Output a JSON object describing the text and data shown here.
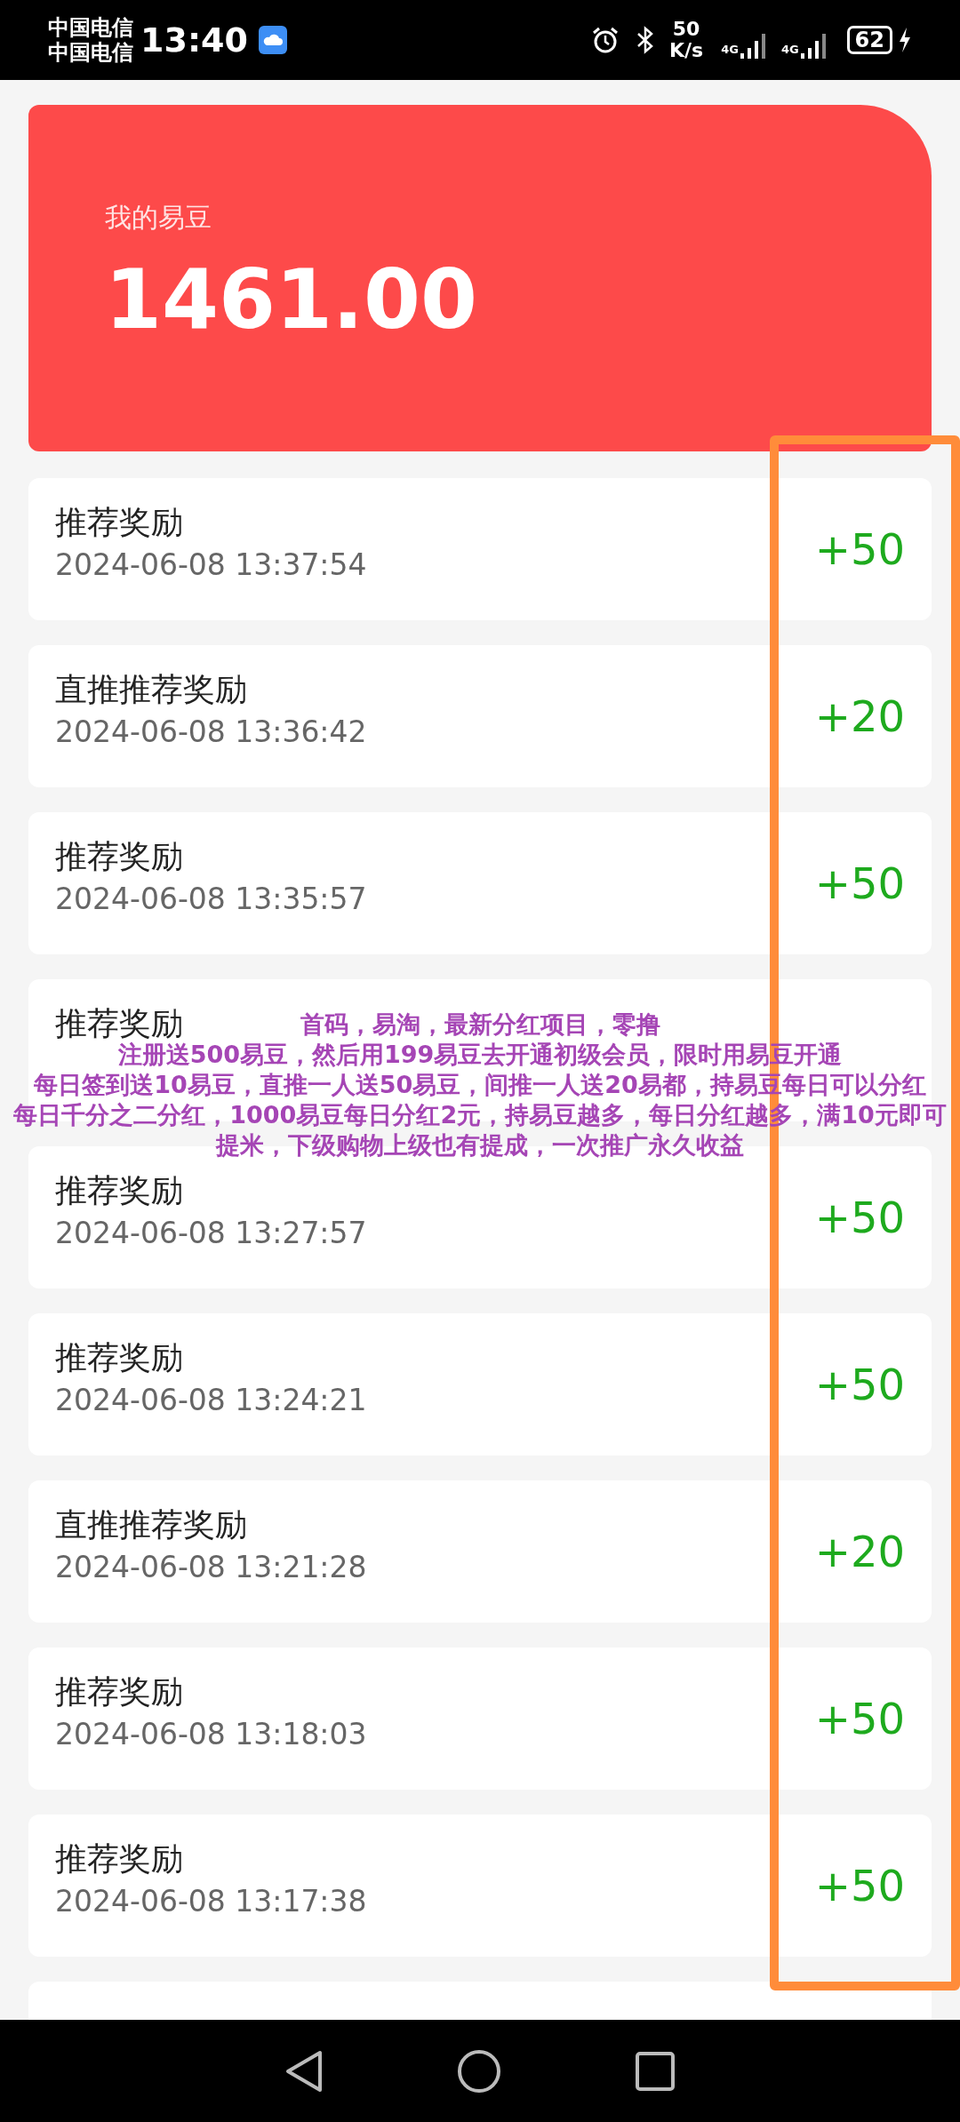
{
  "status_bar": {
    "carriers": [
      "中国电信",
      "中国电信"
    ],
    "time": "13:40",
    "speed_value": "50",
    "speed_unit": "K/s",
    "network_labels": [
      "4G",
      "4G"
    ],
    "battery": "62"
  },
  "balance": {
    "label": "我的易豆",
    "value": "1461.00"
  },
  "records": [
    {
      "title": "推荐奖励",
      "time": "2024-06-08 13:37:54",
      "amount": "+50"
    },
    {
      "title": "直推推荐奖励",
      "time": "2024-06-08 13:36:42",
      "amount": "+20"
    },
    {
      "title": "推荐奖励",
      "time": "2024-06-08 13:35:57",
      "amount": "+50"
    },
    {
      "title": "推荐奖励"
    },
    {
      "title": "推荐奖励",
      "time": "2024-06-08 13:27:57",
      "amount": "+50"
    },
    {
      "title": "推荐奖励",
      "time": "2024-06-08 13:24:21",
      "amount": "+50"
    },
    {
      "title": "直推推荐奖励",
      "time": "2024-06-08 13:21:28",
      "amount": "+20"
    },
    {
      "title": "推荐奖励",
      "time": "2024-06-08 13:18:03",
      "amount": "+50"
    },
    {
      "title": "推荐奖励",
      "time": "2024-06-08 13:17:38",
      "amount": "+50"
    }
  ],
  "overlay_caption": [
    "首码，易淘，最新分红项目，零撸",
    "注册送500易豆，然后用199易豆去开通初级会员，限时用易豆开通",
    "每日签到送10易豆，直推一人送50易豆，间推一人送20易都，持易豆每日可以分红",
    "每日千分之二分红，1000易豆每日分红2元，持易豆越多，每日分红越多，满10元即可提米，下级购物上级也有提成，一次推广永久收益"
  ]
}
